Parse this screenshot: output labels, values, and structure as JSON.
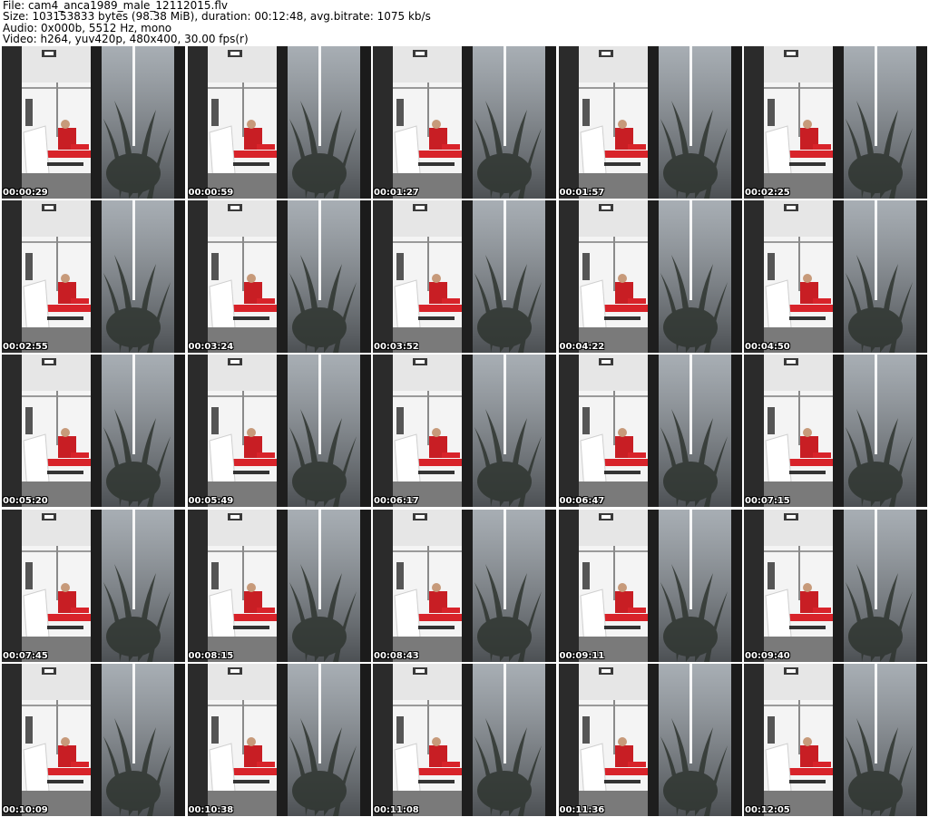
{
  "header": {
    "file_line": "File: cam4_anca1989_male_12112015.flv",
    "size_line": "Size: 103153833 bytes (98.38 MiB), duration: 00:12:48, avg.bitrate: 1075 kb/s",
    "audio_line": "Audio: 0x000b, 5512 Hz, mono",
    "video_line": "Video: h264, yuv420p, 480x400, 30.00 fps(r)"
  },
  "thumbnails": [
    {
      "timestamp": "00:00:29"
    },
    {
      "timestamp": "00:00:59"
    },
    {
      "timestamp": "00:01:27"
    },
    {
      "timestamp": "00:01:57"
    },
    {
      "timestamp": "00:02:25"
    },
    {
      "timestamp": "00:02:55"
    },
    {
      "timestamp": "00:03:24"
    },
    {
      "timestamp": "00:03:52"
    },
    {
      "timestamp": "00:04:22"
    },
    {
      "timestamp": "00:04:50"
    },
    {
      "timestamp": "00:05:20"
    },
    {
      "timestamp": "00:05:49"
    },
    {
      "timestamp": "00:06:17"
    },
    {
      "timestamp": "00:06:47"
    },
    {
      "timestamp": "00:07:15"
    },
    {
      "timestamp": "00:07:45"
    },
    {
      "timestamp": "00:08:15"
    },
    {
      "timestamp": "00:08:43"
    },
    {
      "timestamp": "00:09:11"
    },
    {
      "timestamp": "00:09:40"
    },
    {
      "timestamp": "00:10:09"
    },
    {
      "timestamp": "00:10:38"
    },
    {
      "timestamp": "00:11:08"
    },
    {
      "timestamp": "00:11:36"
    },
    {
      "timestamp": "00:12:05"
    }
  ],
  "colors": {
    "wall": "#f2f2f2",
    "dark_frame": "#2b2b2b",
    "red_accent": "#d8232a",
    "plant": "#3a3a3a"
  }
}
